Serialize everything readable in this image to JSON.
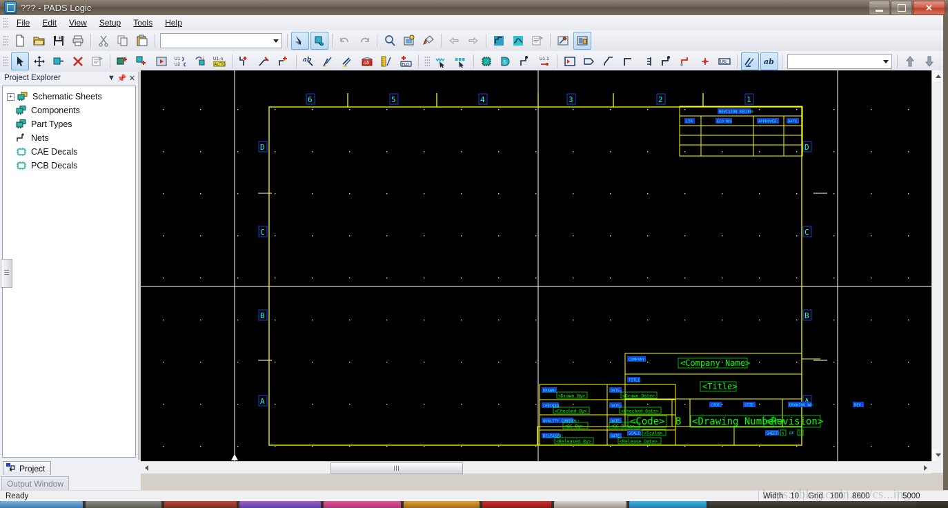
{
  "window": {
    "title": "??? - PADS Logic",
    "app_icon": "pads-logic-icon",
    "minimize_label": "Minimize",
    "maximize_label": "Restore",
    "close_label": "Close"
  },
  "menu": [
    {
      "label": "File",
      "mnemonic": "F"
    },
    {
      "label": "Edit",
      "mnemonic": "E"
    },
    {
      "label": "View",
      "mnemonic": "V"
    },
    {
      "label": "Setup",
      "mnemonic": "S"
    },
    {
      "label": "Tools",
      "mnemonic": "T"
    },
    {
      "label": "Help",
      "mnemonic": "H"
    }
  ],
  "toolbar_standard": {
    "combo_value": "",
    "buttons": [
      {
        "name": "new-file-icon",
        "tip": "New"
      },
      {
        "name": "open-file-icon",
        "tip": "Open"
      },
      {
        "name": "save-icon",
        "tip": "Save"
      },
      {
        "name": "print-icon",
        "tip": "Print"
      },
      {
        "name": "cut-icon",
        "tip": "Cut"
      },
      {
        "name": "copy-icon",
        "tip": "Copy"
      },
      {
        "name": "paste-icon",
        "tip": "Paste"
      },
      {
        "name": "select-filter-icon",
        "tip": "Selection Filter"
      },
      {
        "name": "select-net-icon",
        "tip": "Select Net"
      },
      {
        "name": "undo-icon",
        "tip": "Undo"
      },
      {
        "name": "redo-icon",
        "tip": "Redo"
      },
      {
        "name": "zoom-icon",
        "tip": "Zoom"
      },
      {
        "name": "sheet-view-icon",
        "tip": "Sheet View"
      },
      {
        "name": "refresh-paint-icon",
        "tip": "Redraw"
      },
      {
        "name": "previous-sheet-icon",
        "tip": "Previous Sheet"
      },
      {
        "name": "next-sheet-icon",
        "tip": "Next Sheet"
      },
      {
        "name": "net-route-icon",
        "tip": "Nets"
      },
      {
        "name": "bus-icon",
        "tip": "Bus"
      },
      {
        "name": "report-icon",
        "tip": "Reports"
      },
      {
        "name": "design-tool-icon",
        "tip": "Design Tools"
      },
      {
        "name": "library-icon",
        "tip": "Library Manager"
      }
    ]
  },
  "toolbar_design": {
    "combo_value": "",
    "buttons": [
      {
        "name": "select-arrow-icon",
        "tip": "Select"
      },
      {
        "name": "move-icon",
        "tip": "Move"
      },
      {
        "name": "copy-part-icon",
        "tip": "Copy Entity"
      },
      {
        "name": "delete-icon",
        "tip": "Delete"
      },
      {
        "name": "properties-icon",
        "tip": "Properties"
      },
      {
        "name": "add-part-icon",
        "tip": "Add Part"
      },
      {
        "name": "add-connection-icon",
        "tip": "Add Connection"
      },
      {
        "name": "add-sheet-icon",
        "tip": "Add Sheet"
      },
      {
        "name": "swap-pins-icon",
        "tip": "Swap Pins"
      },
      {
        "name": "swap-gates-icon",
        "tip": "Swap Gates"
      },
      {
        "name": "auto-rename-icon",
        "tip": "Auto Rename"
      },
      {
        "name": "add-net-flag-icon",
        "tip": "Add Net Flag"
      },
      {
        "name": "edit-net-icon",
        "tip": "Edit Net"
      },
      {
        "name": "add-signal-icon",
        "tip": "Add Signal"
      },
      {
        "name": "edit-ref-icon",
        "tip": "Edit Reference"
      },
      {
        "name": "edit-attr-icon",
        "tip": "Edit Attributes"
      },
      {
        "name": "edit-text-icon",
        "tip": "Edit Text"
      },
      {
        "name": "label-ab-icon",
        "tip": "Label"
      },
      {
        "name": "ruler-icon",
        "tip": "Measure"
      },
      {
        "name": "add-field-icon",
        "tip": "Add Field"
      },
      {
        "name": "select-nets-icon",
        "tip": "Select Nets"
      },
      {
        "name": "select-parts-icon",
        "tip": "Select Parts"
      },
      {
        "name": "chip-icon",
        "tip": "Part"
      },
      {
        "name": "gate-buffer-icon",
        "tip": "Gate"
      },
      {
        "name": "pin-icon",
        "tip": "Pin"
      },
      {
        "name": "part-pin-icon",
        "tip": "Part Pin"
      },
      {
        "name": "hierarchy-block-icon",
        "tip": "Hierarchy"
      },
      {
        "name": "off-page-icon",
        "tip": "Off Page Symbol"
      },
      {
        "name": "bus-tap-icon",
        "tip": "Bus Tap"
      },
      {
        "name": "corner-icon",
        "tip": "Corner"
      },
      {
        "name": "terminal-icon",
        "tip": "Terminal"
      },
      {
        "name": "connector-icon",
        "tip": "Connector"
      },
      {
        "name": "junction-icon",
        "tip": "Junction"
      },
      {
        "name": "net-point-icon",
        "tip": "Net Point"
      },
      {
        "name": "lbl-icon",
        "tip": "LBL"
      },
      {
        "name": "net-highlight-icon",
        "tip": "Highlight Net"
      },
      {
        "name": "text-ab-icon",
        "tip": "Text"
      },
      {
        "name": "move-up-icon",
        "tip": "Move Up"
      },
      {
        "name": "move-down-icon",
        "tip": "Move Down"
      }
    ]
  },
  "project_explorer": {
    "title": "Project Explorer",
    "menu_icon": "chevron-down-icon",
    "pin_icon": "pin-icon",
    "close_icon": "close-icon",
    "items": [
      {
        "label": "Schematic Sheets",
        "icon": "schematic-sheets-icon",
        "expandable": true
      },
      {
        "label": "Components",
        "icon": "components-icon",
        "expandable": false
      },
      {
        "label": "Part Types",
        "icon": "part-types-icon",
        "expandable": false
      },
      {
        "label": "Nets",
        "icon": "nets-icon",
        "expandable": false
      },
      {
        "label": "CAE Decals",
        "icon": "cae-decals-icon",
        "expandable": false
      },
      {
        "label": "PCB Decals",
        "icon": "pcb-decals-icon",
        "expandable": false
      }
    ],
    "tab_label": "Project",
    "tab_icon": "project-icon",
    "output_window_label": "Output Window"
  },
  "canvas": {
    "background": "#000000",
    "border_color": "#ffff00",
    "text_color": "#00ff00",
    "label_color": "#00ffff",
    "label_box_color": "#0000ff",
    "sheet_line_color": "#ffffff",
    "zone_columns": [
      "6",
      "5",
      "4",
      "3",
      "2",
      "1"
    ],
    "zone_rows": [
      "D",
      "C",
      "B",
      "A"
    ],
    "revision_record": {
      "title": "REVISION RECORD",
      "headers": [
        "LTR",
        "ECO NO:",
        "APPROVED:",
        "DATE:"
      ],
      "rows": [
        [
          "",
          "",
          "",
          ""
        ],
        [
          "",
          "",
          "",
          ""
        ],
        [
          "",
          "",
          "",
          ""
        ],
        [
          "",
          "",
          "",
          ""
        ]
      ]
    },
    "title_block": {
      "company_label": "COMPANY:",
      "company_value": "<Company Name>",
      "title_label": "TITLE:",
      "title_value": "<Title>",
      "code_label": "CODE:",
      "code_value": "<Code>",
      "size_label": "SIZE:",
      "size_value": "B",
      "drawing_no_label": "DRAWING NO:",
      "drawing_no_value": "<Drawing Number>",
      "rev_label": "REV:",
      "rev_value": "<Revision>",
      "scale_label": "SCALE:",
      "scale_value": "<Scale>",
      "sheet_label": "SHEET:",
      "sheet_value": "n",
      "sheet_of_label": "OF",
      "sheet_total": "1",
      "signoff": [
        {
          "label": "DRAWN:",
          "value": "<Drawn By>",
          "date_label": "DATE:",
          "date_value": "<Drawn Date>"
        },
        {
          "label": "CHECKED:",
          "value": "<Checked By>",
          "date_label": "DATE:",
          "date_value": "<Checked Date>"
        },
        {
          "label": "QUALITY CONTROL:",
          "value": "<QC By>",
          "date_label": "DATE:",
          "date_value": "<QC Date>"
        },
        {
          "label": "RELEASED:",
          "value": "<Released By>",
          "date_label": "DATE:",
          "date_value": "<Release Date>"
        }
      ]
    }
  },
  "statusbar": {
    "message": "Ready",
    "width_label": "Width",
    "width_value": "10",
    "grid_label": "Grid",
    "grid_value": "100",
    "x_value": "8600",
    "y_value": "5000",
    "watermark": "https://blog.csdn.net/cs...ing"
  }
}
